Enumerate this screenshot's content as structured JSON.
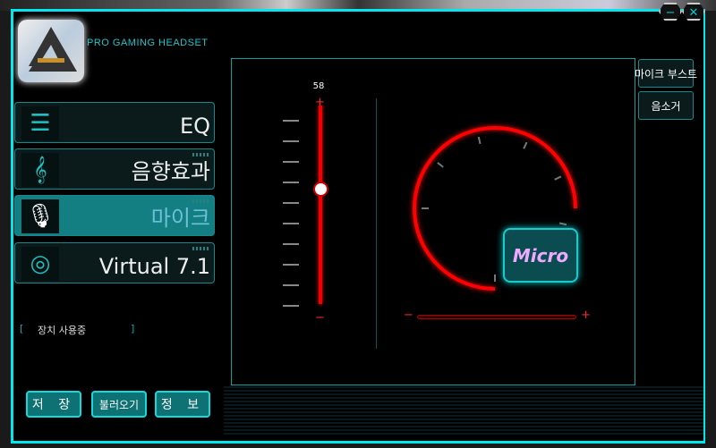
{
  "header": {
    "brand": "PRO GAMING HEADSET",
    "minimize_icon": "minimize-icon",
    "close_icon": "close-icon"
  },
  "nav": [
    {
      "label": "EQ",
      "icon": "equalizer-icon"
    },
    {
      "label": "음향효과",
      "icon": "treble-clef-icon"
    },
    {
      "label": "마이크",
      "icon": "microphone-icon",
      "active": true
    },
    {
      "label": "Virtual 7.1",
      "icon": "surround-headphone-icon"
    }
  ],
  "status": "장치 사용중",
  "buttons": {
    "save": "저 장",
    "load": "불러오기",
    "info": "정 보"
  },
  "mic": {
    "volume": 58,
    "volume_max": 100,
    "boost_label": "마이크 부스트",
    "mute_label": "음소거",
    "micro_label": "Micro"
  },
  "colors": {
    "accent": "#00e8ee",
    "slider": "#ff0000"
  }
}
